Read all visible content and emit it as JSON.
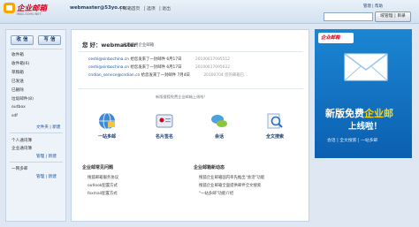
{
  "header": {
    "logo_text": "企业邮箱",
    "logo_sub": "MAIL.SOHU.NET",
    "user_email": "webmaster@53yo.cn",
    "top_links": [
      "| 邮箱首页",
      "| 选项",
      "| 退出"
    ],
    "manage_link": "管理 | 帮助",
    "search_button": "域管理 | 目录"
  },
  "sidebar": {
    "receive_button": "收 信",
    "compose_button": "写 信",
    "folders": [
      "收件箱",
      "收件箱(6)",
      "草稿箱",
      "已发送",
      "已删除",
      "垃圾邮件(8)",
      "outbox",
      "sdf"
    ],
    "folder_links": "文件夹 | 新建",
    "address_book": "个人通讯簿",
    "company_book": "企业通讯簿",
    "addr_links": "管理 | 新建",
    "netdisk": "一网多邮",
    "netdisk_links": "管理 | 新建"
  },
  "main": {
    "greeting": "您 好：webmaster",
    "greeting_sub": "欢迎使用企业邮箱",
    "messages": [
      {
        "from": "ceshi@sinbochina.cn",
        "text": "给您发来了一封邮件 6月17日",
        "id": "20100617095512"
      },
      {
        "from": "ceshi@sinbochina.cn",
        "text": "给您发来了一封邮件 6月17日",
        "id": "20100617095622"
      },
      {
        "from": "cndian_service@cndian.cn",
        "text": "给您发来了一封邮件 7月4日",
        "id": "20100704 您的邮箱已..."
      }
    ],
    "notice": "新版搜狐免费企业邮箱上线啦!",
    "features": [
      "一站多邮",
      "名片签名",
      "会话",
      "全文搜索"
    ],
    "faq_left_title": "企业邮常见问题",
    "faq_left": [
      "搜狐邮箱服务协议",
      "outlook配置方式",
      "foxmail配置方式"
    ],
    "faq_right_title": "企业邮箱新动态",
    "faq_right": [
      "搜狐企业邮箱国内率先推出\"会话\"功能",
      "搜狐企业邮箱全面提供邮件全文搜索",
      "\"一站多邮\"功能介绍"
    ]
  },
  "ad": {
    "logo_text": "企业邮箱",
    "line1_a": "新版免费",
    "line1_b": "企业邮",
    "line2": "上线啦！",
    "line3": "会话 | 全文搜索 | 一站多邮"
  },
  "colors": {
    "brand_red": "#d2001e",
    "link_blue": "#1a4f9c",
    "ad_blue": "#1b86d3"
  }
}
